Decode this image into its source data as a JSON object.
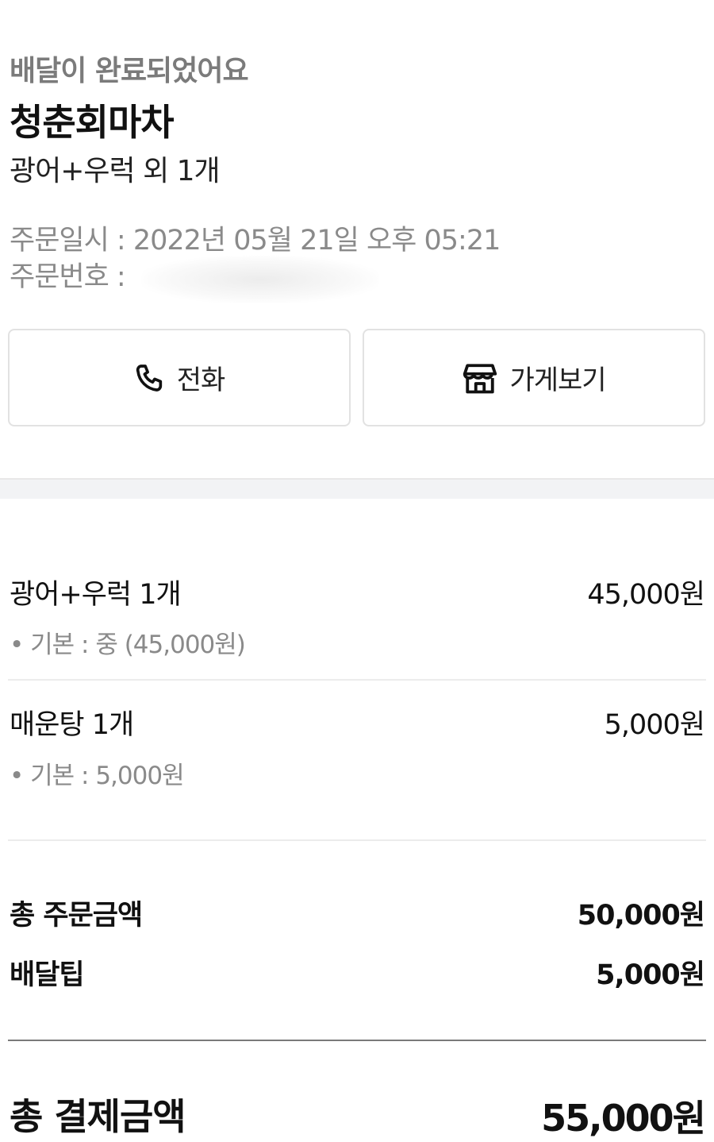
{
  "order": {
    "status": "배달이 완료되었어요",
    "store_name": "청춘회마차",
    "summary": "광어+우럭 외 1개",
    "date_line": "주문일시 : 2022년 05월 21일 오후 05:21",
    "number_label": "주문번호 :"
  },
  "buttons": {
    "call_label": "전화",
    "call_icon": "phone-icon",
    "store_label": "가게보기",
    "store_icon": "store-icon"
  },
  "items": [
    {
      "name": "광어+우럭 1개",
      "price": "45,000원",
      "option": "• 기본 : 중 (45,000원)"
    },
    {
      "name": "매운탕 1개",
      "price": "5,000원",
      "option": "• 기본 : 5,000원"
    }
  ],
  "subtotals": {
    "order_amount_label": "총 주문금액",
    "order_amount_value": "50,000원",
    "delivery_tip_label": "배달팁",
    "delivery_tip_value": "5,000원"
  },
  "total": {
    "label": "총 결제금액",
    "value": "55,000원"
  }
}
